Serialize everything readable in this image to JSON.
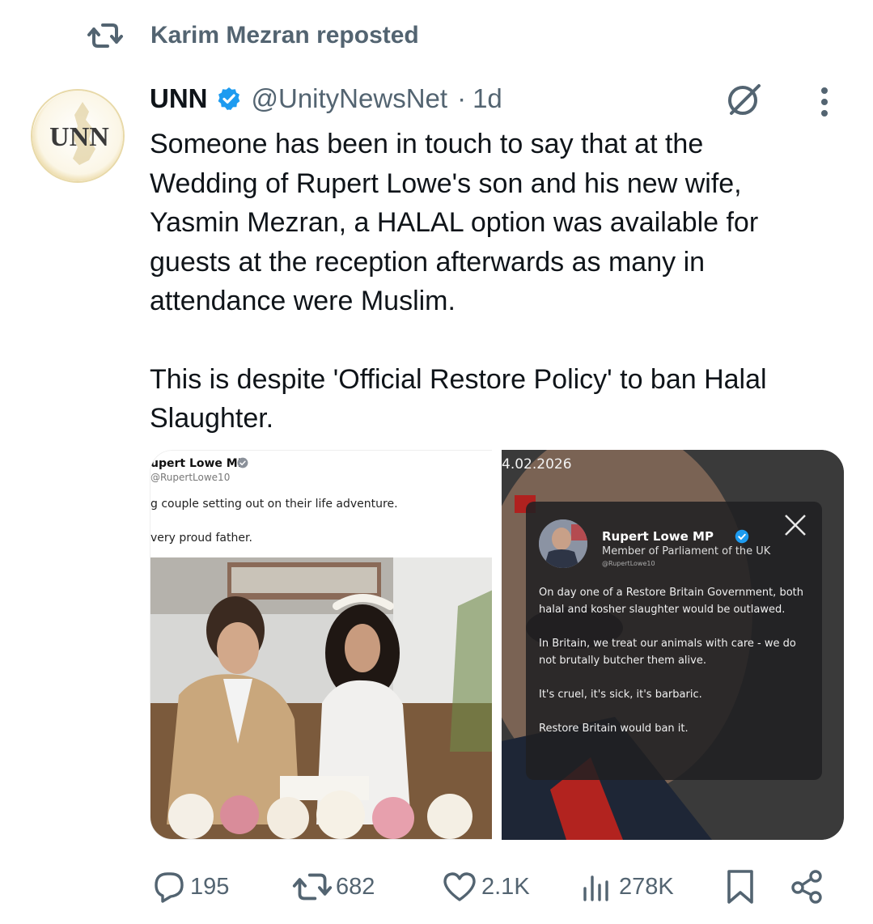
{
  "repost": {
    "text": "Karim Mezran reposted",
    "icon": "repost-icon"
  },
  "author": {
    "avatar_text": "UNN",
    "name": "UNN",
    "verified": true,
    "handle": "@UnityNewsNet",
    "time": "1d",
    "separator": "·"
  },
  "tweet": {
    "paragraphs": [
      "Someone has been in touch to say that at the\nWedding of Rupert Lowe's son and his new wife,\nYasmin Mezran, a HALAL option was available for\nguests at the reception afterwards as many in\nattendance were Muslim.",
      "This is despite 'Official Restore Policy' to ban Halal\nSlaughter."
    ]
  },
  "media_left": {
    "name": "upert Lowe MP",
    "handle": "@RupertLowe10",
    "line1": "g couple setting out on their life adventure.",
    "line2": "very proud father."
  },
  "media_right": {
    "date": "4.02.2026",
    "card_name": "Rupert Lowe MP",
    "card_title": "Member of Parliament of the UK",
    "card_handle": "@RupertLowe10",
    "paragraphs": [
      "On day one of a Restore Britain Government, both halal and kosher slaughter would be outlawed.",
      "In Britain, we treat our animals with care - we do not brutally butcher them alive.",
      "It's cruel, it's sick, it's barbaric.",
      "Restore Britain would ban it."
    ]
  },
  "actions": {
    "replies": "195",
    "reposts": "682",
    "likes": "2.1K",
    "views": "278K"
  },
  "colors": {
    "accent": "#1d9bf0",
    "muted": "#536471",
    "text": "#0f1419"
  }
}
